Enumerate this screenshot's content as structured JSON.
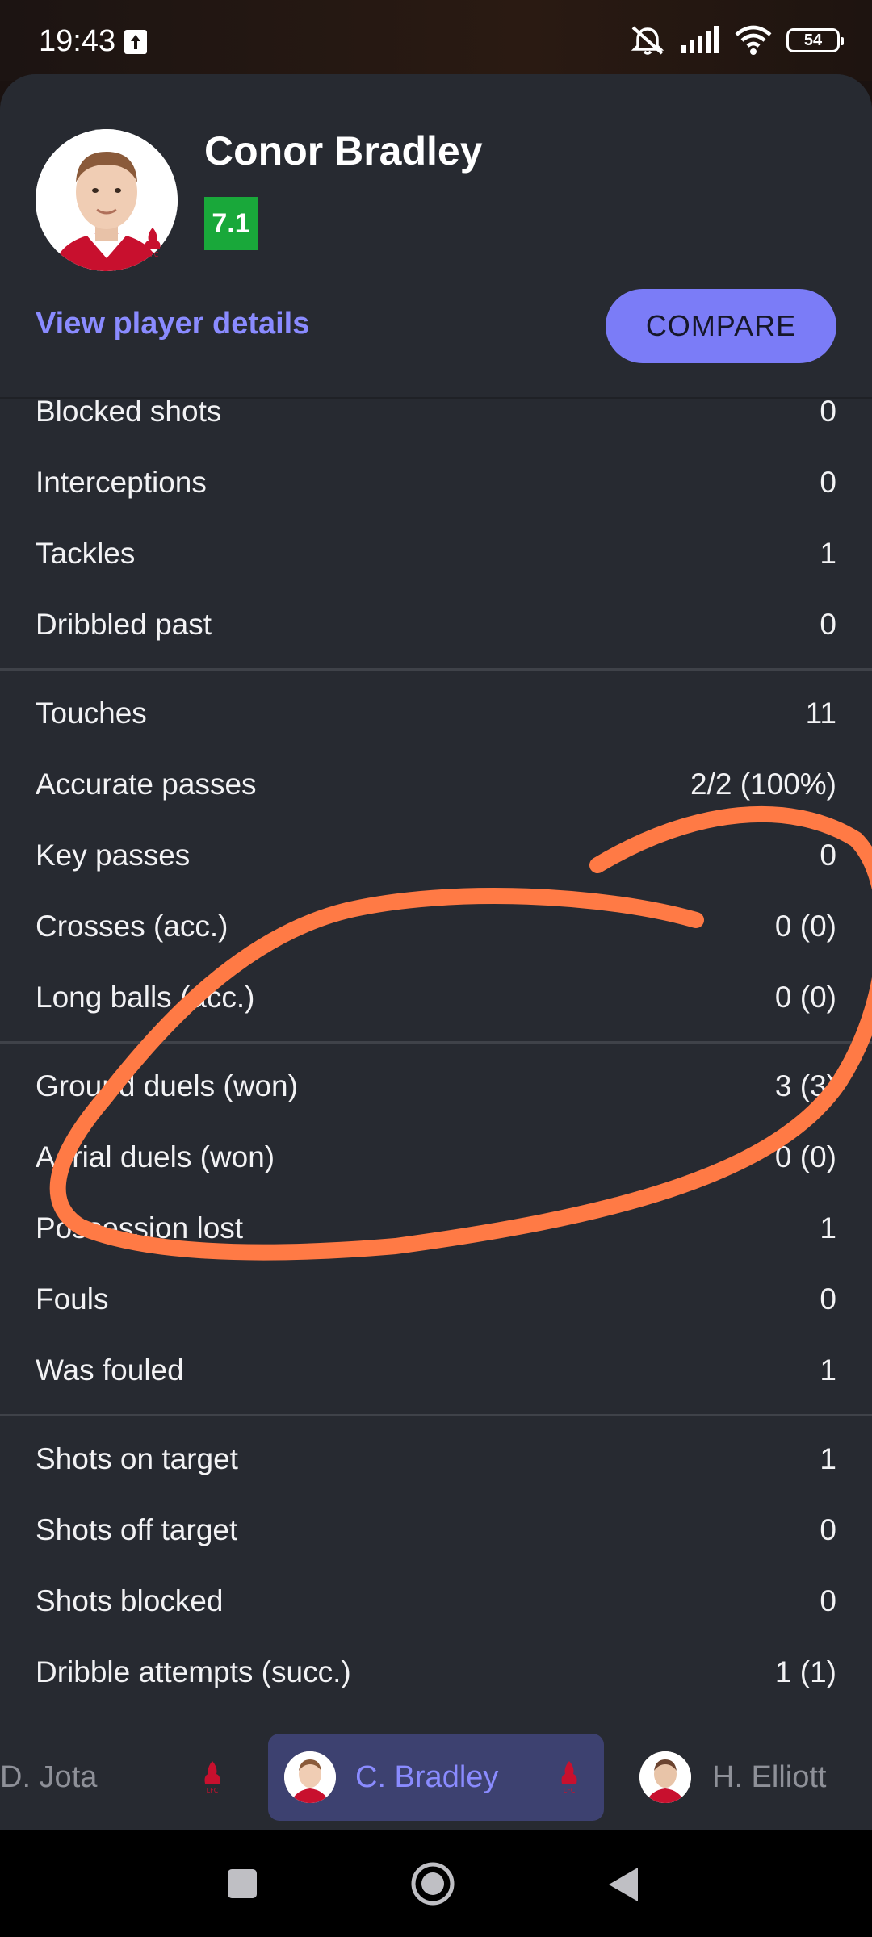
{
  "status_bar": {
    "time": "19:43",
    "battery": "54",
    "icons": [
      "upload-icon",
      "mute-icon",
      "signal-icon",
      "wifi-icon",
      "battery-icon"
    ]
  },
  "player": {
    "name": "Conor Bradley",
    "rating": "7.1",
    "rating_color": "#19a83a",
    "details_link": "View player details",
    "compare_label": "COMPARE"
  },
  "stats": {
    "defense": [
      {
        "label": "Blocked shots",
        "value": "0"
      },
      {
        "label": "Interceptions",
        "value": "0"
      },
      {
        "label": "Tackles",
        "value": "1"
      },
      {
        "label": "Dribbled past",
        "value": "0"
      }
    ],
    "passing": [
      {
        "label": "Touches",
        "value": "11"
      },
      {
        "label": "Accurate passes",
        "value": "2/2 (100%)"
      },
      {
        "label": "Key passes",
        "value": "0"
      },
      {
        "label": "Crosses (acc.)",
        "value": "0 (0)"
      },
      {
        "label": "Long balls (acc.)",
        "value": "0 (0)"
      }
    ],
    "duels": [
      {
        "label": "Ground duels (won)",
        "value": "3 (3)"
      },
      {
        "label": "Aerial duels (won)",
        "value": "0 (0)"
      },
      {
        "label": "Possession lost",
        "value": "1"
      },
      {
        "label": "Fouls",
        "value": "0"
      },
      {
        "label": "Was fouled",
        "value": "1"
      }
    ],
    "attack": [
      {
        "label": "Shots on target",
        "value": "1"
      },
      {
        "label": "Shots off target",
        "value": "0"
      },
      {
        "label": "Shots blocked",
        "value": "0"
      },
      {
        "label": "Dribble attempts (succ.)",
        "value": "1 (1)"
      }
    ]
  },
  "player_tabs": [
    {
      "label": "D. Jota",
      "active": false
    },
    {
      "label": "C. Bradley",
      "active": true
    },
    {
      "label": "H. Elliott",
      "active": false
    }
  ],
  "colors": {
    "accent": "#7b7cf7",
    "sheet_bg": "#272a31",
    "annotation": "#ff7a45",
    "club_red": "#c8102e"
  },
  "nav_bar": {
    "icons": [
      "recents-square-icon",
      "home-circle-icon",
      "back-triangle-icon"
    ]
  }
}
